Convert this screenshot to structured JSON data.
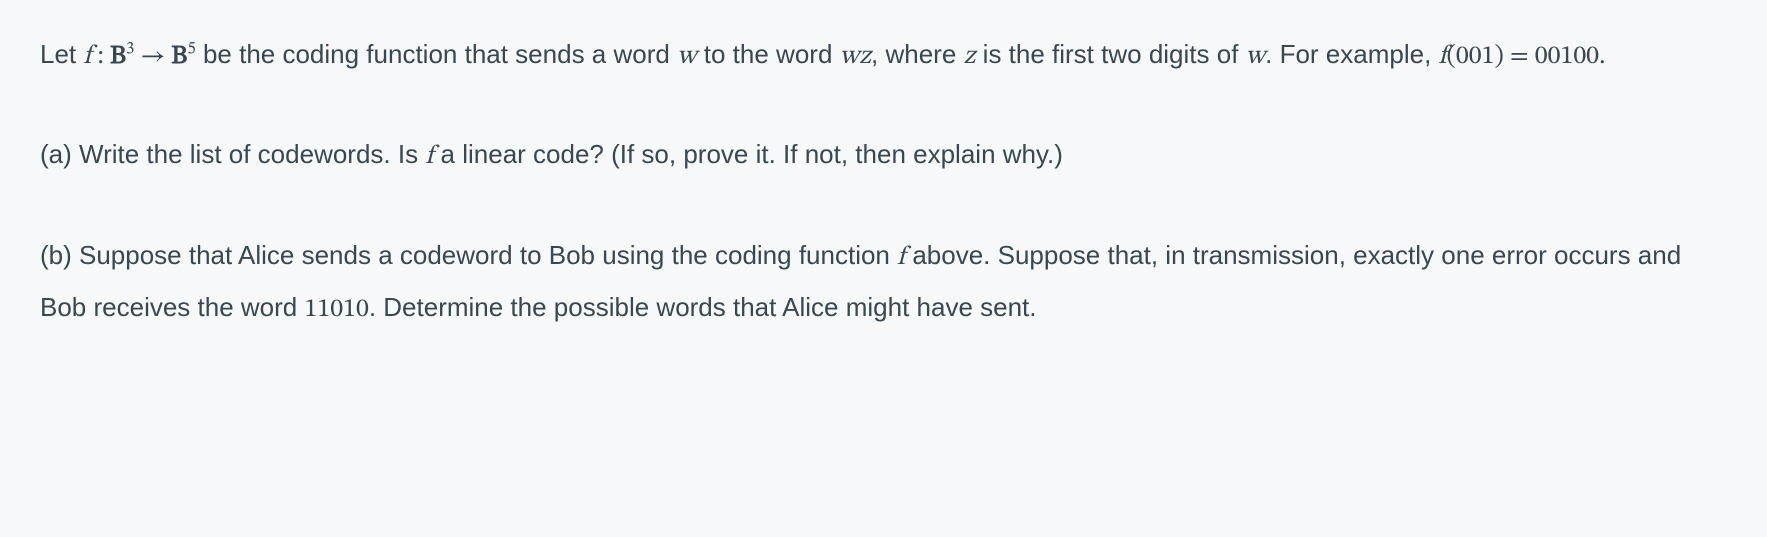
{
  "p1": {
    "t1": "Let ",
    "fn": "f",
    "colon": " : ",
    "B1": "B",
    "exp1": "3",
    "arrow": " → ",
    "B2": "B",
    "exp2": "5",
    "t2": " be the coding function that sends a word ",
    "w1": "w",
    "t3": " to the word ",
    "wz": "wz",
    "t4": ", where ",
    "z": "z",
    "t5": " is the first two digits of ",
    "w2": "w",
    "t6": ". For example, ",
    "fn2": "f",
    "lp": "(",
    "arg": "001",
    "rp": ")",
    "eq": " = ",
    "res": "00100",
    "dot": "."
  },
  "p2": {
    "t1": "(a) Write the list of codewords. Is ",
    "fn": "f",
    "t2": " a linear code? (If so, prove it. If not, then explain why.)"
  },
  "p3": {
    "t1": "(b) Suppose that Alice sends a codeword to Bob using the coding function ",
    "fn": "f",
    "t2": " above. Suppose that, in transmission, exactly one error occurs and Bob receives the word ",
    "num": "11010",
    "t3": ". Determine the possible words that Alice might have sent."
  }
}
